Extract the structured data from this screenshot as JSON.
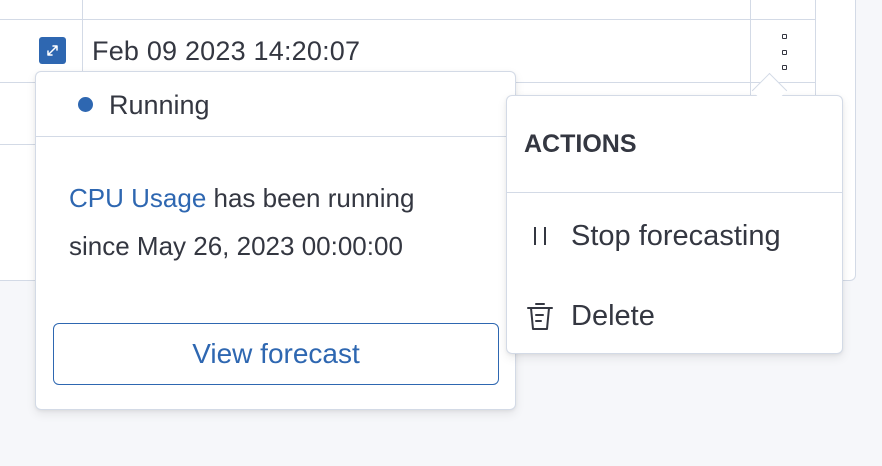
{
  "table": {
    "row": {
      "timestamp": "Feb 09 2023 14:20:07"
    }
  },
  "status_popover": {
    "status": "Running",
    "status_color": "#2e67b1",
    "link_text": "CPU Usage",
    "description_line1": " has been running",
    "description_line2": "since May 26, 2023 00:00:00",
    "view_button_label": "View forecast"
  },
  "actions_menu": {
    "title": "ACTIONS",
    "items": [
      {
        "label": "Stop forecasting",
        "icon": "pause-icon"
      },
      {
        "label": "Delete",
        "icon": "trash-icon"
      }
    ]
  },
  "colors": {
    "accent": "#2e67b1",
    "text": "#343741",
    "border": "#d3dae6"
  }
}
